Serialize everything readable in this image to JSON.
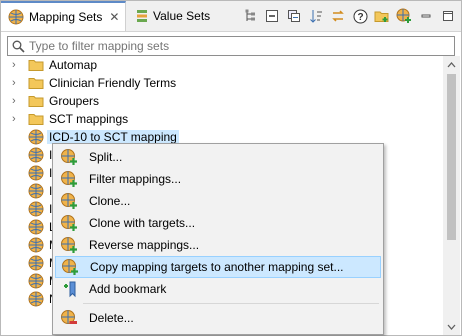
{
  "tabs": [
    {
      "label": "Mapping Sets",
      "icon": "globe-icon",
      "active": true
    },
    {
      "label": "Value Sets",
      "icon": "value-sets-icon",
      "active": false
    }
  ],
  "toolbar": {
    "icons": [
      "hierarchy-icon",
      "collapse-all-icon",
      "link-editor-icon",
      "sort-icon",
      "swap-icon",
      "help-icon",
      "folder-add-icon",
      "globe-add-icon",
      "minimize-icon",
      "maximize-icon"
    ]
  },
  "filter": {
    "placeholder": "Type to filter mapping sets",
    "value": ""
  },
  "tree": {
    "items": [
      {
        "label": "Automap",
        "type": "folder"
      },
      {
        "label": "Clinician Friendly Terms",
        "type": "folder"
      },
      {
        "label": "Groupers",
        "type": "folder"
      },
      {
        "label": "SCT mappings",
        "type": "folder"
      },
      {
        "label": "ICD-10 to SCT mapping",
        "type": "mapping-set",
        "selected": true
      },
      {
        "label": "I",
        "type": "mapping-set"
      },
      {
        "label": "I",
        "type": "mapping-set"
      },
      {
        "label": "I",
        "type": "mapping-set"
      },
      {
        "label": "I",
        "type": "mapping-set"
      },
      {
        "label": "L",
        "type": "mapping-set"
      },
      {
        "label": "M",
        "type": "mapping-set"
      },
      {
        "label": "M",
        "type": "mapping-set"
      },
      {
        "label": "M",
        "type": "mapping-set"
      },
      {
        "label": "N",
        "type": "mapping-set"
      }
    ]
  },
  "context_menu": {
    "items": [
      {
        "label": "Split...",
        "icon": "globe-add-icon"
      },
      {
        "label": "Filter mappings...",
        "icon": "globe-add-icon"
      },
      {
        "label": "Clone...",
        "icon": "globe-add-icon"
      },
      {
        "label": "Clone with targets...",
        "icon": "globe-add-icon"
      },
      {
        "label": "Reverse mappings...",
        "icon": "globe-add-icon"
      },
      {
        "label": "Copy mapping targets to another mapping set...",
        "icon": "globe-add-icon",
        "highlighted": true
      },
      {
        "label": "Add bookmark",
        "icon": "bookmark-add-icon"
      },
      {
        "label": "Delete...",
        "icon": "globe-delete-icon"
      }
    ]
  },
  "colors": {
    "selection": "#cce8ff",
    "accent": "#5e8ac7",
    "folder": "#f3c75a",
    "globe": "#e8a33a",
    "plus": "#2e9c3a"
  }
}
